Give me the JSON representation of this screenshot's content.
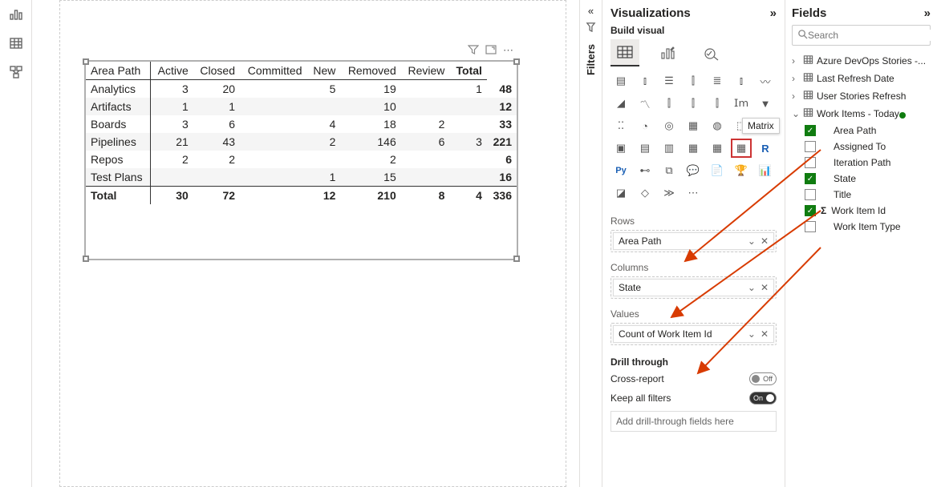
{
  "rail": {
    "chart": "chart-icon",
    "table": "table-icon",
    "model": "model-icon"
  },
  "filters_label": "Filters",
  "visualizations": {
    "title": "Visualizations",
    "subhead": "Build visual",
    "tooltip": "Matrix",
    "rows_label": "Rows",
    "columns_label": "Columns",
    "values_label": "Values",
    "rows_item": "Area Path",
    "columns_item": "State",
    "values_item": "Count of Work Item Id",
    "drill_label": "Drill through",
    "cross_report_label": "Cross-report",
    "cross_report_value": "Off",
    "keep_filters_label": "Keep all filters",
    "keep_filters_value": "On",
    "drill_drop_placeholder": "Add drill-through fields here"
  },
  "fields": {
    "title": "Fields",
    "search_placeholder": "Search",
    "tables": [
      {
        "name": "Azure DevOps Stories -...",
        "expanded": false
      },
      {
        "name": "Last Refresh Date",
        "expanded": false
      },
      {
        "name": "User Stories Refresh",
        "expanded": false
      },
      {
        "name": "Work Items - Today",
        "expanded": true
      }
    ],
    "work_items_fields": [
      {
        "label": "Area Path",
        "checked": true,
        "sigma": false
      },
      {
        "label": "Assigned To",
        "checked": false,
        "sigma": false
      },
      {
        "label": "Iteration Path",
        "checked": false,
        "sigma": false
      },
      {
        "label": "State",
        "checked": true,
        "sigma": false
      },
      {
        "label": "Title",
        "checked": false,
        "sigma": false
      },
      {
        "label": "Work Item Id",
        "checked": true,
        "sigma": true
      },
      {
        "label": "Work Item Type",
        "checked": false,
        "sigma": false
      }
    ]
  },
  "chart_data": {
    "type": "table",
    "title": "",
    "row_header": "Area Path",
    "columns": [
      "Active",
      "Closed",
      "Committed",
      "New",
      "Removed",
      "Review",
      "Total"
    ],
    "rows": [
      {
        "label": "Analytics",
        "values": [
          3,
          20,
          null,
          5,
          19,
          null,
          1,
          48
        ]
      },
      {
        "label": "Artifacts",
        "values": [
          1,
          1,
          null,
          null,
          10,
          null,
          null,
          12
        ]
      },
      {
        "label": "Boards",
        "values": [
          3,
          6,
          null,
          4,
          18,
          2,
          null,
          33
        ]
      },
      {
        "label": "Pipelines",
        "values": [
          21,
          43,
          null,
          2,
          146,
          6,
          3,
          221
        ]
      },
      {
        "label": "Repos",
        "values": [
          2,
          2,
          null,
          null,
          2,
          null,
          null,
          6
        ]
      },
      {
        "label": "Test Plans",
        "values": [
          null,
          null,
          null,
          1,
          15,
          null,
          null,
          16
        ]
      }
    ],
    "totals": {
      "label": "Total",
      "values": [
        30,
        72,
        null,
        12,
        210,
        8,
        4,
        336
      ]
    }
  }
}
